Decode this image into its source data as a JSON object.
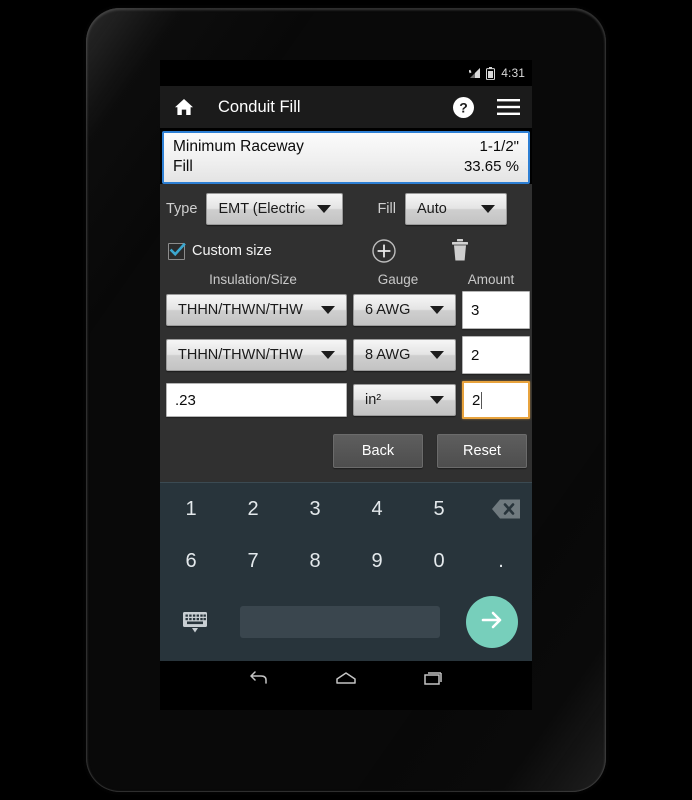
{
  "status_bar": {
    "time": "4:31",
    "icons": [
      "signal-icon",
      "battery-icon"
    ]
  },
  "app_bar": {
    "home_icon": "home-icon",
    "title": "Conduit Fill",
    "help_icon": "help-icon",
    "menu_icon": "menu-icon"
  },
  "result_panel": {
    "rows": [
      {
        "label": "Minimum Raceway",
        "value": "1-1/2\""
      },
      {
        "label": "Fill",
        "value": "33.65 %"
      }
    ],
    "border_color": "#2d7fd4"
  },
  "form": {
    "type_label": "Type",
    "type_value": "EMT (Electric",
    "fill_label": "Fill",
    "fill_value": "Auto",
    "custom_size_label": "Custom size",
    "custom_size_checked": true,
    "add_icon": "plus-circle-icon",
    "delete_icon": "trash-icon",
    "headers": {
      "insulation": "Insulation/Size",
      "gauge": "Gauge",
      "amount": "Amount"
    },
    "rows": [
      {
        "insulation": "THHN/THWN/THW",
        "gauge": "6 AWG",
        "amount": "3",
        "insulation_type": "spinner",
        "gauge_type": "spinner",
        "amount_focused": false
      },
      {
        "insulation": "THHN/THWN/THW",
        "gauge": "8 AWG",
        "amount": "2",
        "insulation_type": "spinner",
        "gauge_type": "spinner",
        "amount_focused": false
      },
      {
        "insulation": ".23",
        "gauge": "in²",
        "amount": "2",
        "insulation_type": "text",
        "gauge_type": "spinner",
        "amount_focused": true
      }
    ],
    "focus_color": "#e8a33d"
  },
  "actions": {
    "back_label": "Back",
    "reset_label": "Reset"
  },
  "keyboard": {
    "row1": [
      "1",
      "2",
      "3",
      "4",
      "5"
    ],
    "backspace_icon": "backspace-icon",
    "row2": [
      "6",
      "7",
      "8",
      "9",
      "0",
      "."
    ],
    "switch_icon": "keyboard-switch-icon",
    "spacebar": "",
    "enter_icon": "arrow-right-icon",
    "background_color": "#28343b",
    "enter_color": "#77cfbb"
  },
  "nav_bar": {
    "back_icon": "nav-back-icon",
    "home_icon": "nav-home-icon",
    "recents_icon": "nav-recents-icon"
  }
}
